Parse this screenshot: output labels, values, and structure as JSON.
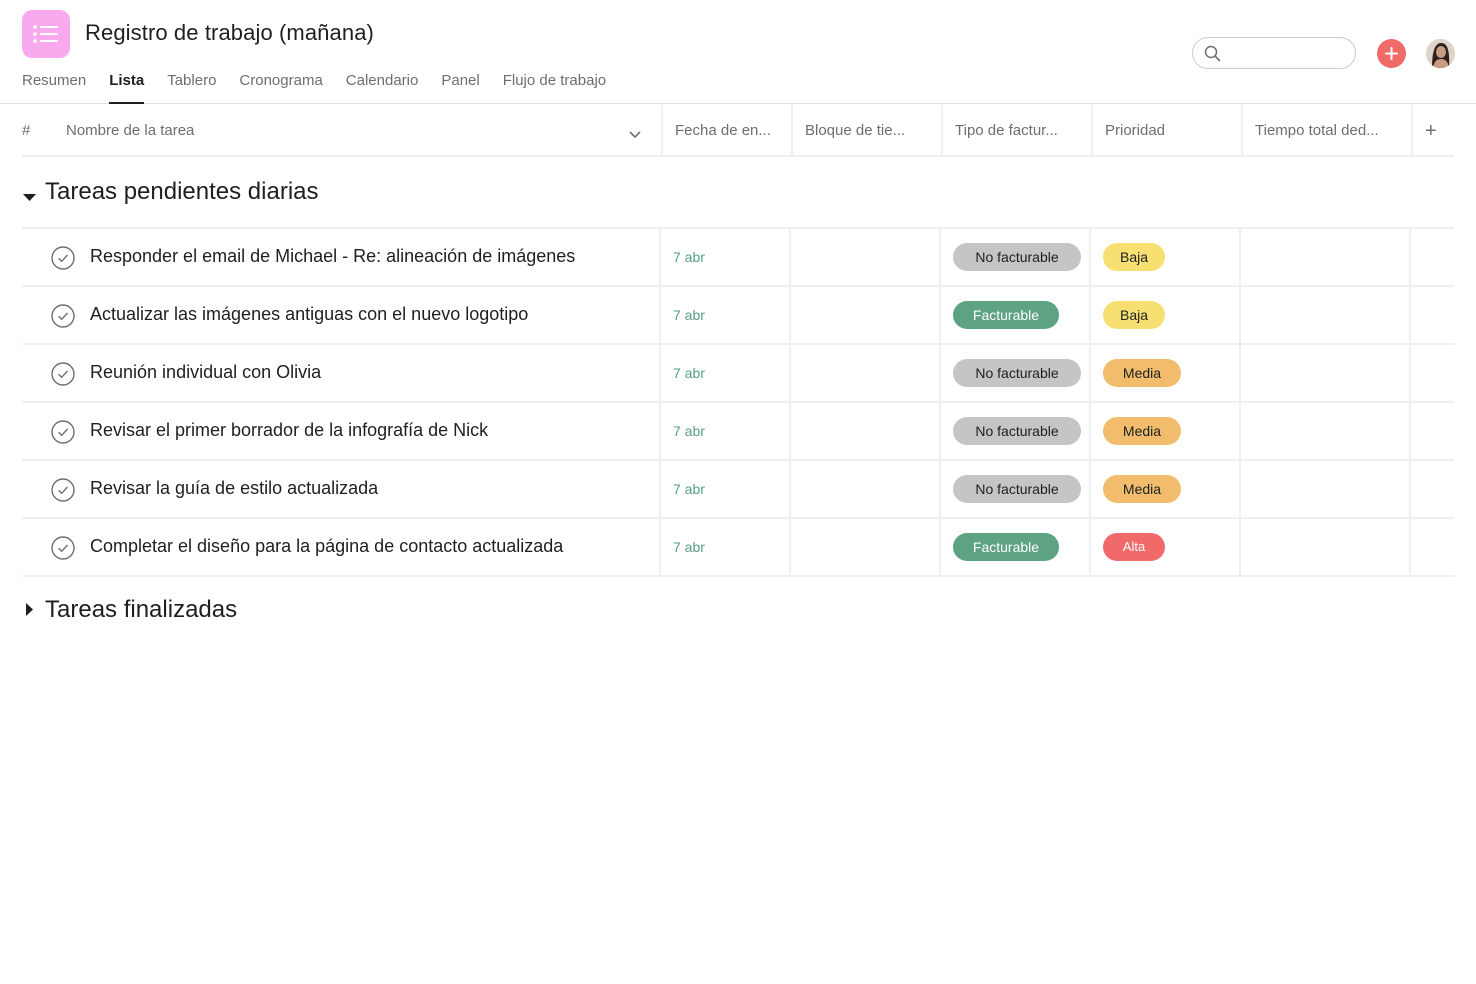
{
  "project": {
    "title": "Registro de trabajo (mañana)",
    "icon": "list-icon",
    "icon_color": "#f9aaef"
  },
  "tabs": [
    {
      "label": "Resumen"
    },
    {
      "label": "Lista",
      "active": true
    },
    {
      "label": "Tablero"
    },
    {
      "label": "Cronograma"
    },
    {
      "label": "Calendario"
    },
    {
      "label": "Panel"
    },
    {
      "label": "Flujo de trabajo"
    }
  ],
  "search": {
    "placeholder": "",
    "value": ""
  },
  "colors": {
    "add_button": "#f06a6a",
    "date": "#58a182",
    "facturable": "#5da283",
    "no_facturable": "#c7c4c4",
    "baja": "#f8df72",
    "media": "#f1bd6c",
    "alta": "#f06a6a"
  },
  "columns": {
    "number": "#",
    "name": "Nombre de la tarea",
    "due": "Fecha de en...",
    "time_block": "Bloque de tie...",
    "billing": "Tipo de factur...",
    "priority": "Prioridad",
    "total_time": "Tiempo total ded...",
    "add": "+"
  },
  "sections": [
    {
      "title": "Tareas pendientes diarias",
      "expanded": true,
      "tasks": [
        {
          "name": "Responder el email de Michael - Re: alineación de imágenes",
          "due": "7 abr",
          "billing": "No facturable",
          "priority": "Baja"
        },
        {
          "name": "Actualizar las imágenes antiguas con el nuevo logotipo",
          "due": "7 abr",
          "billing": "Facturable",
          "priority": "Baja"
        },
        {
          "name": "Reunión individual con Olivia",
          "due": "7 abr",
          "billing": "No facturable",
          "priority": "Media"
        },
        {
          "name": "Revisar el primer borrador de la infografía de Nick",
          "due": "7 abr",
          "billing": "No facturable",
          "priority": "Media"
        },
        {
          "name": "Revisar la guía de estilo actualizada",
          "due": "7 abr",
          "billing": "No facturable",
          "priority": "Media"
        },
        {
          "name": "Completar el diseño para la página de contacto actualizada",
          "due": "7 abr",
          "billing": "Facturable",
          "priority": "Alta"
        }
      ]
    },
    {
      "title": "Tareas finalizadas",
      "expanded": false,
      "tasks": []
    }
  ]
}
